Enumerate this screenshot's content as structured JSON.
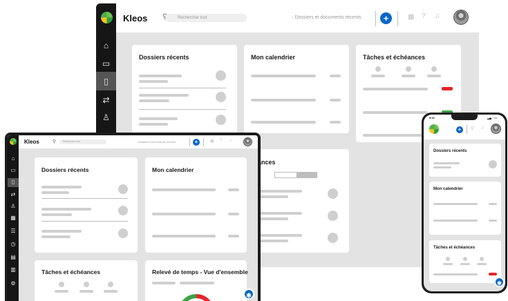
{
  "app": {
    "brand": "Kleos"
  },
  "colors": {
    "accent": "#0a67c8",
    "sidebar": "#161616",
    "canvas": "#e3e3e3",
    "alert": "#e5242b",
    "ok": "#3aa345"
  },
  "header": {
    "search_placeholder": "Rechercher tout",
    "recent_label": "Dossiers et documents récents",
    "recent_label_short": "Dossiers et documents récents",
    "add_glyph": "+",
    "icons": [
      "search-icon",
      "add-icon",
      "calendar-icon",
      "help-icon",
      "bell-icon",
      "avatar"
    ]
  },
  "sidebar": {
    "items": [
      {
        "name": "home",
        "glyph": "⌂"
      },
      {
        "name": "folders",
        "glyph": "▭"
      },
      {
        "name": "documents",
        "glyph": "▯"
      },
      {
        "name": "transfers",
        "glyph": "⇄"
      },
      {
        "name": "contacts",
        "glyph": "♙"
      },
      {
        "name": "calendar",
        "glyph": "▦"
      },
      {
        "name": "tasks",
        "glyph": "☰"
      },
      {
        "name": "time",
        "glyph": "◷"
      },
      {
        "name": "billing",
        "glyph": "▤"
      },
      {
        "name": "reports",
        "glyph": "▥"
      },
      {
        "name": "settings",
        "glyph": "⚙"
      }
    ]
  },
  "widgets": {
    "recent_folders": "Dossiers récents",
    "calendar": "Mon calendrier",
    "tasks": "Tâches et échéances",
    "tasks_partial": "ances",
    "time": "Relevé de temps - Vue d'ensemble"
  },
  "fab_glyph": "✱"
}
